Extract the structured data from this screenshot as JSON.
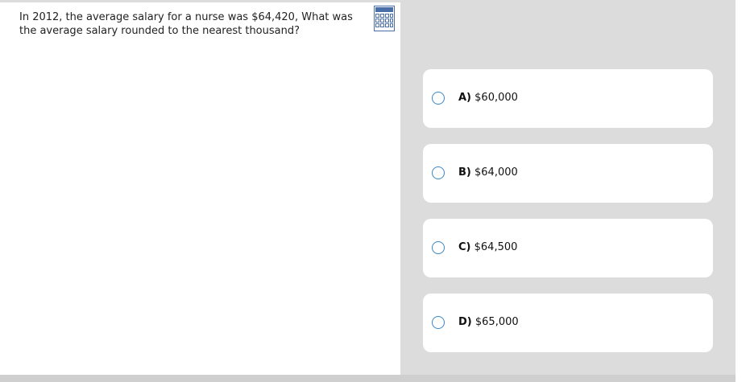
{
  "question": {
    "text": "In 2012, the average salary for a nurse was $64,420, What was the average salary rounded to the nearest thousand?"
  },
  "toolbar": {
    "calculator_icon": "calculator-icon"
  },
  "choices": [
    {
      "letter": "A)",
      "value": "$60,000",
      "selected": false
    },
    {
      "letter": "B)",
      "value": "$64,000",
      "selected": false
    },
    {
      "letter": "C)",
      "value": "$64,500",
      "selected": false
    },
    {
      "letter": "D)",
      "value": "$65,000",
      "selected": false
    }
  ],
  "colors": {
    "radio_border": "#3a86c6",
    "answers_bg": "#dcdcdc",
    "calculator_blue": "#4a6fa8"
  }
}
